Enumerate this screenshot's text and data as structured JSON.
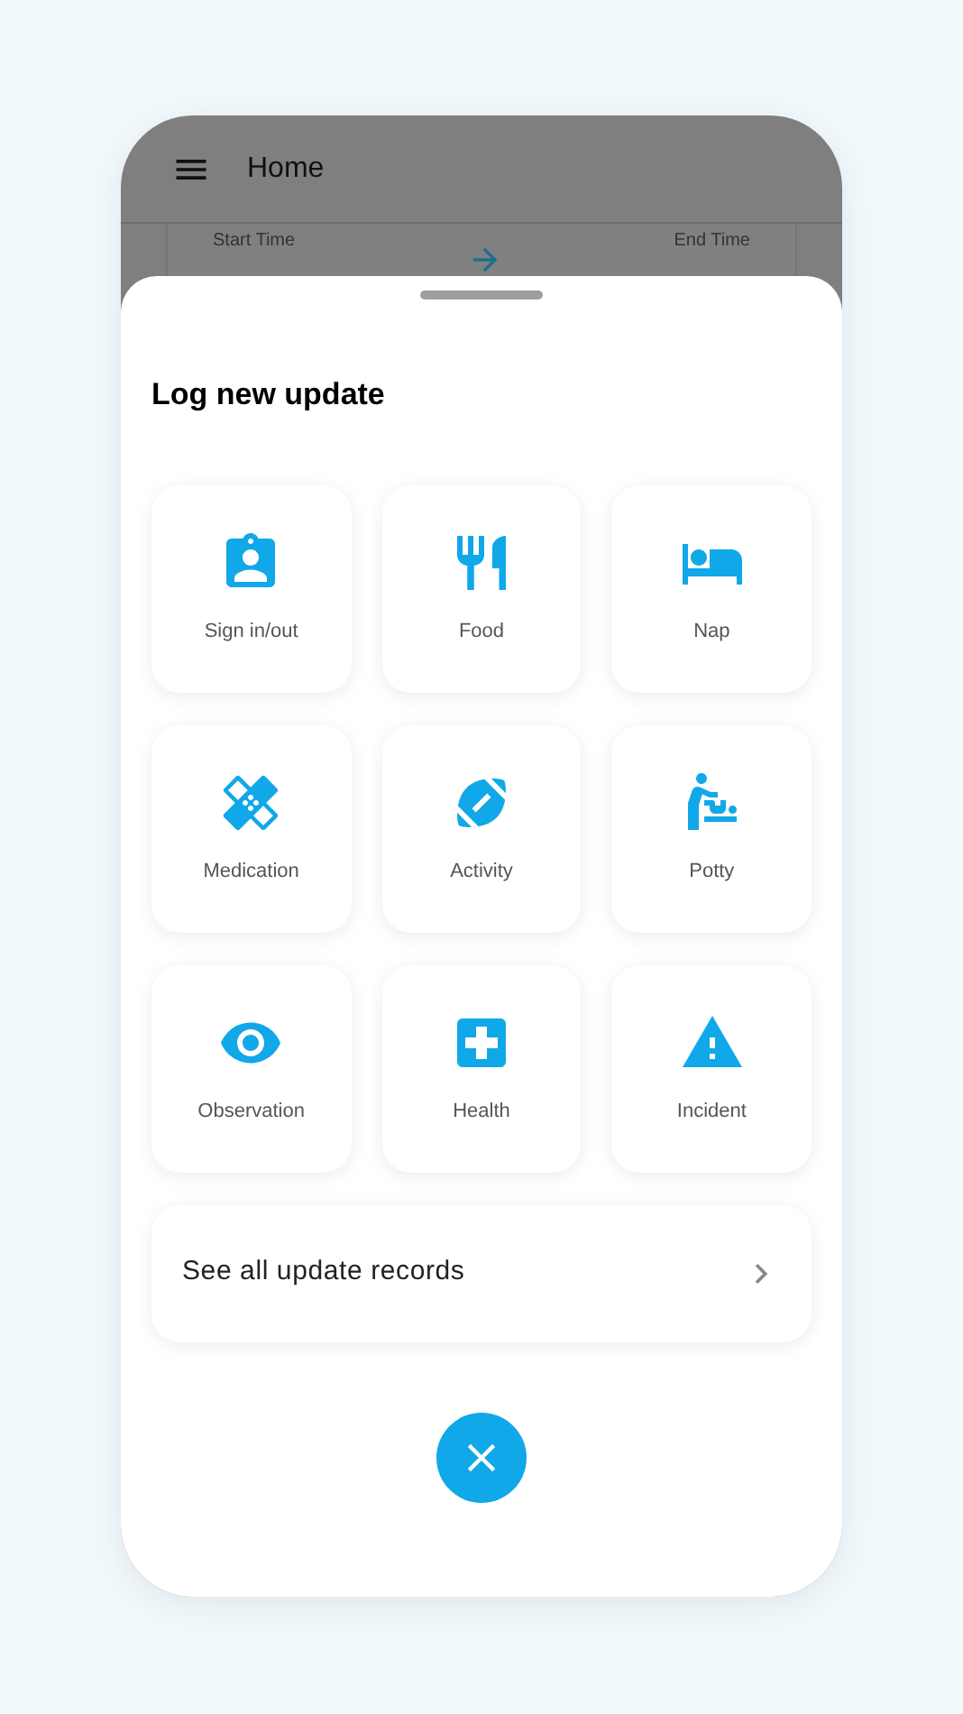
{
  "header": {
    "title": "Home"
  },
  "time_card": {
    "start_label": "Start Time",
    "end_label": "End Time"
  },
  "sheet": {
    "title": "Log new update",
    "tiles": [
      {
        "label": "Sign in/out"
      },
      {
        "label": "Food"
      },
      {
        "label": "Nap"
      },
      {
        "label": "Medication"
      },
      {
        "label": "Activity"
      },
      {
        "label": "Potty"
      },
      {
        "label": "Observation"
      },
      {
        "label": "Health"
      },
      {
        "label": "Incident"
      }
    ],
    "records_link": "See all update records"
  }
}
